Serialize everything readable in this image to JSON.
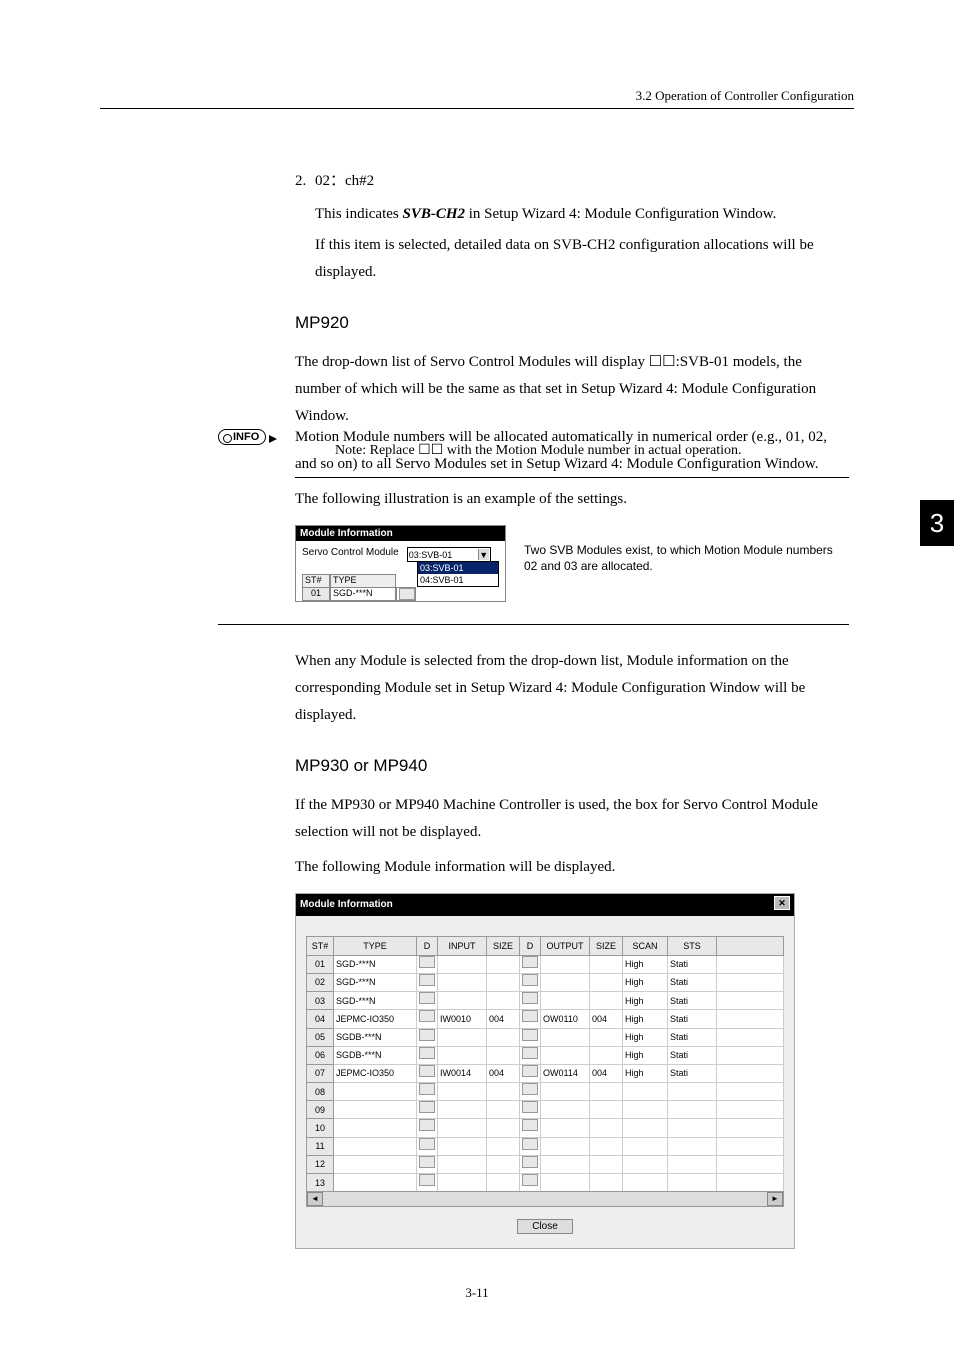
{
  "header": {
    "section_title": "3.2  Operation of Controller Configuration"
  },
  "item2": {
    "num": "2.",
    "label": "02：ch#2",
    "p1_a": "This indicates ",
    "p1_b": "SVB-CH2",
    "p1_c": " in Setup Wizard 4: Module Configuration Window.",
    "p2": "If this item is selected, detailed data on SVB-CH2 configuration allocations will be displayed."
  },
  "mp920": {
    "heading": "MP920",
    "p1": "The drop-down list of Servo Control Modules will display ☐☐:SVB-01 models, the number of which will be the same as that set in Setup Wizard 4: Module Configuration Window.",
    "note": "Note: Replace ☐☐ with the Motion Module number in actual operation."
  },
  "info": {
    "badge": "INFO",
    "p1": "Motion Module numbers will be allocated automatically in numerical order (e.g., 01, 02, and so on) to all Servo Modules set in Setup Wizard 4: Module Configuration Window.",
    "p2": "The following illustration is an example of the settings."
  },
  "fig1": {
    "title": "Module Information",
    "label": "Servo Control Module",
    "selected": "03:SVB-01",
    "options": [
      "03:SVB-01",
      "04:SVB-01"
    ],
    "th_st": "ST#",
    "th_type": "TYPE",
    "row_st": "01",
    "row_type": "SGD-***N",
    "caption": "Two SVB Modules exist, to which Motion Module numbers 02 and 03 are allocated."
  },
  "between": {
    "p1": "When any Module is selected from the drop-down list, Module information on the corresponding Module set in Setup Wizard 4: Module Configuration Window will be displayed."
  },
  "mp930": {
    "heading": "MP930 or MP940",
    "p1": "If the MP930 or MP940 Machine Controller is used, the box for Servo Control Module selection will not be displayed.",
    "p2": "The following Module information will be displayed."
  },
  "fig2": {
    "title": "Module Information",
    "headers": [
      "ST#",
      "TYPE",
      "D",
      "INPUT",
      "SIZE",
      "D",
      "OUTPUT",
      "SIZE",
      "SCAN",
      "STS",
      ""
    ],
    "close_button": "Close"
  },
  "chart_data": {
    "type": "table",
    "title": "Module Information",
    "columns": [
      "ST#",
      "TYPE",
      "D",
      "INPUT",
      "SIZE",
      "D",
      "OUTPUT",
      "SIZE",
      "SCAN",
      "STS"
    ],
    "rows": [
      {
        "ST#": "01",
        "TYPE": "SGD-***N",
        "INPUT": "",
        "SIZE_IN": "",
        "OUTPUT": "",
        "SIZE_OUT": "",
        "SCAN": "High",
        "STS": "Stati"
      },
      {
        "ST#": "02",
        "TYPE": "SGD-***N",
        "INPUT": "",
        "SIZE_IN": "",
        "OUTPUT": "",
        "SIZE_OUT": "",
        "SCAN": "High",
        "STS": "Stati"
      },
      {
        "ST#": "03",
        "TYPE": "SGD-***N",
        "INPUT": "",
        "SIZE_IN": "",
        "OUTPUT": "",
        "SIZE_OUT": "",
        "SCAN": "High",
        "STS": "Stati"
      },
      {
        "ST#": "04",
        "TYPE": "JEPMC-IO350",
        "INPUT": "IW0010",
        "SIZE_IN": "004",
        "OUTPUT": "OW0110",
        "SIZE_OUT": "004",
        "SCAN": "High",
        "STS": "Stati"
      },
      {
        "ST#": "05",
        "TYPE": "SGDB-***N",
        "INPUT": "",
        "SIZE_IN": "",
        "OUTPUT": "",
        "SIZE_OUT": "",
        "SCAN": "High",
        "STS": "Stati"
      },
      {
        "ST#": "06",
        "TYPE": "SGDB-***N",
        "INPUT": "",
        "SIZE_IN": "",
        "OUTPUT": "",
        "SIZE_OUT": "",
        "SCAN": "High",
        "STS": "Stati"
      },
      {
        "ST#": "07",
        "TYPE": "JEPMC-IO350",
        "INPUT": "IW0014",
        "SIZE_IN": "004",
        "OUTPUT": "OW0114",
        "SIZE_OUT": "004",
        "SCAN": "High",
        "STS": "Stati"
      },
      {
        "ST#": "08",
        "TYPE": "",
        "INPUT": "",
        "SIZE_IN": "",
        "OUTPUT": "",
        "SIZE_OUT": "",
        "SCAN": "",
        "STS": ""
      },
      {
        "ST#": "09",
        "TYPE": "",
        "INPUT": "",
        "SIZE_IN": "",
        "OUTPUT": "",
        "SIZE_OUT": "",
        "SCAN": "",
        "STS": ""
      },
      {
        "ST#": "10",
        "TYPE": "",
        "INPUT": "",
        "SIZE_IN": "",
        "OUTPUT": "",
        "SIZE_OUT": "",
        "SCAN": "",
        "STS": ""
      },
      {
        "ST#": "11",
        "TYPE": "",
        "INPUT": "",
        "SIZE_IN": "",
        "OUTPUT": "",
        "SIZE_OUT": "",
        "SCAN": "",
        "STS": ""
      },
      {
        "ST#": "12",
        "TYPE": "",
        "INPUT": "",
        "SIZE_IN": "",
        "OUTPUT": "",
        "SIZE_OUT": "",
        "SCAN": "",
        "STS": ""
      },
      {
        "ST#": "13",
        "TYPE": "",
        "INPUT": "",
        "SIZE_IN": "",
        "OUTPUT": "",
        "SIZE_OUT": "",
        "SCAN": "",
        "STS": ""
      }
    ]
  },
  "page_tab": "3",
  "footer": "3-11"
}
